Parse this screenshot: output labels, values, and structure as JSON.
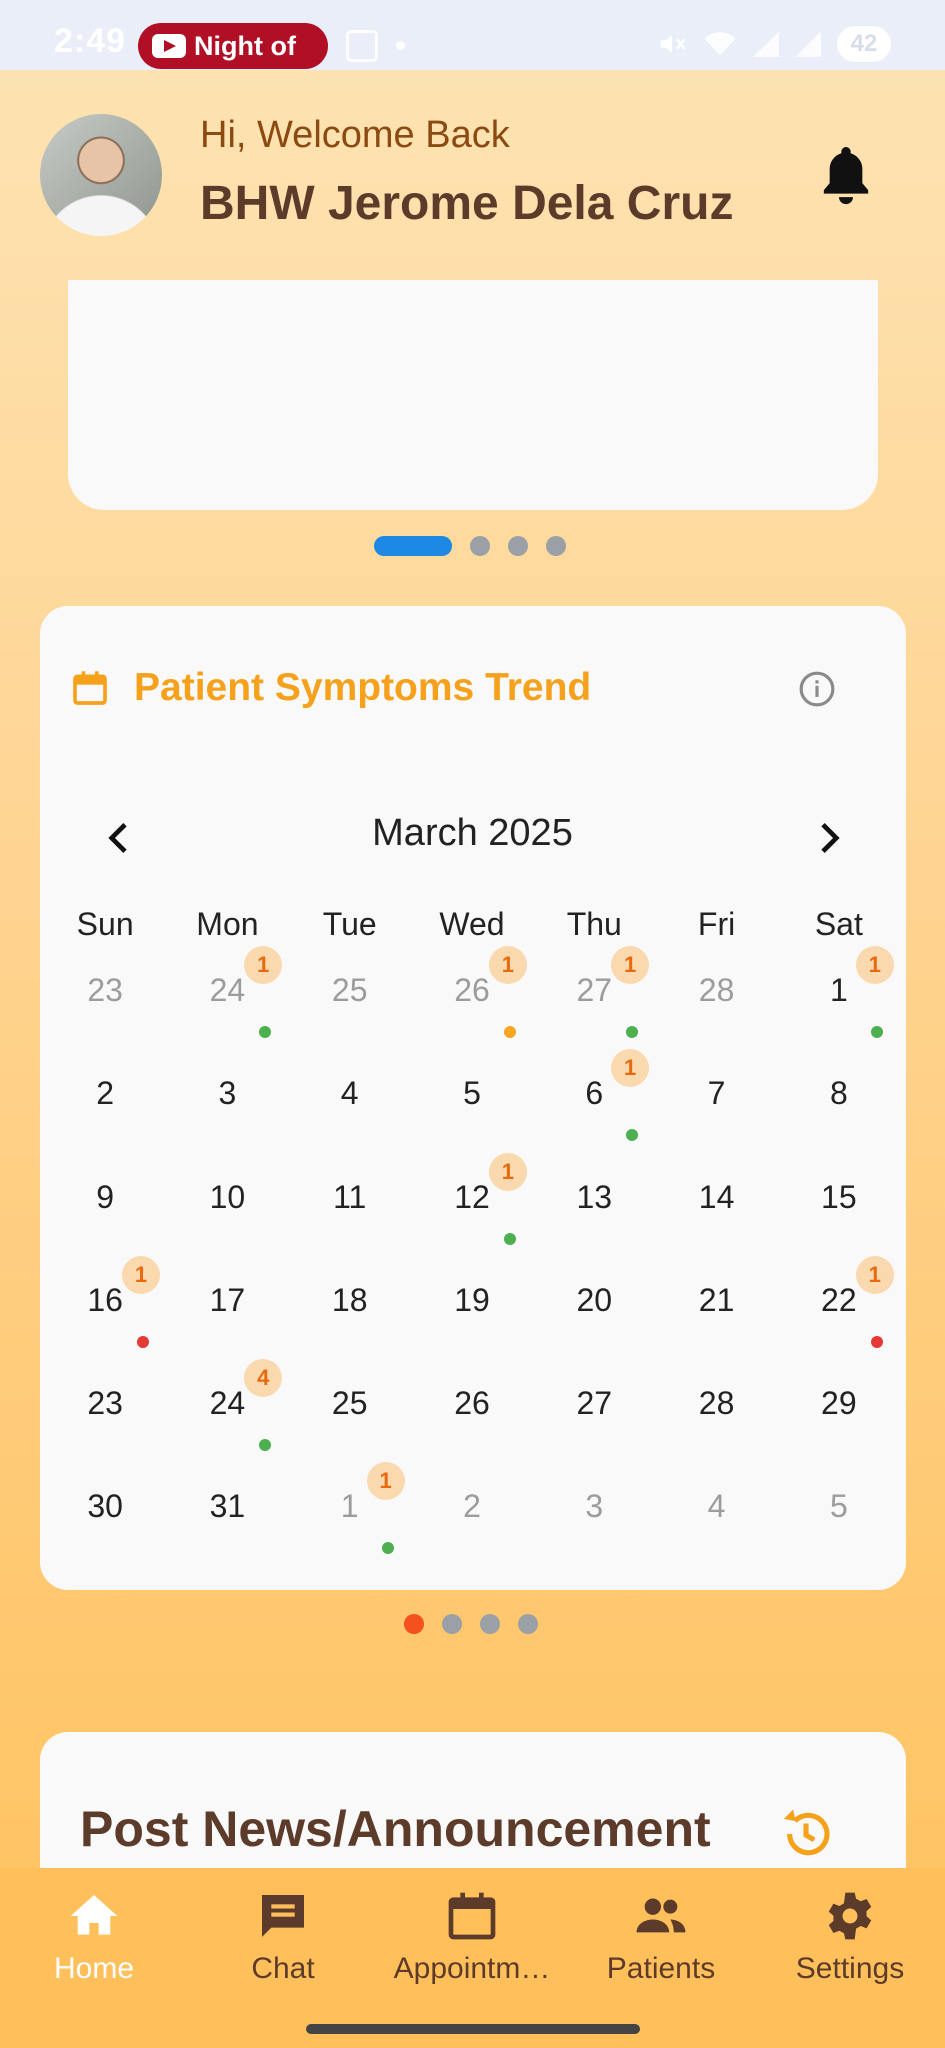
{
  "status_bar": {
    "time": "2:49",
    "media_pill_text": "Night of",
    "battery": "42",
    "icons": [
      "youtube-icon",
      "screenshot-icon",
      "mute-icon",
      "wifi-icon",
      "signal-icon",
      "signal-icon",
      "battery-icon"
    ]
  },
  "header": {
    "greeting": "Hi, Welcome Back",
    "user_name": "BHW Jerome Dela Cruz",
    "notification_icon": "bell-icon"
  },
  "carousel": {
    "pages": 4,
    "active_page": 1,
    "active_color": "#1e88e5"
  },
  "symptoms_card": {
    "title": "Patient Symptoms Trend",
    "title_color": "#f5a11b",
    "month_label": "March 2025",
    "weekdays": [
      "Sun",
      "Mon",
      "Tue",
      "Wed",
      "Thu",
      "Fri",
      "Sat"
    ],
    "days": [
      {
        "n": "23",
        "muted": true
      },
      {
        "n": "24",
        "muted": true,
        "badge": "1",
        "mark": "#4caf50"
      },
      {
        "n": "25",
        "muted": true
      },
      {
        "n": "26",
        "muted": true,
        "badge": "1",
        "mark": "#f5a623"
      },
      {
        "n": "27",
        "muted": true,
        "badge": "1",
        "mark": "#4caf50"
      },
      {
        "n": "28",
        "muted": true
      },
      {
        "n": "1",
        "badge": "1",
        "mark": "#4caf50"
      },
      {
        "n": "2"
      },
      {
        "n": "3"
      },
      {
        "n": "4"
      },
      {
        "n": "5"
      },
      {
        "n": "6",
        "badge": "1",
        "mark": "#4caf50"
      },
      {
        "n": "7"
      },
      {
        "n": "8"
      },
      {
        "n": "9"
      },
      {
        "n": "10"
      },
      {
        "n": "11"
      },
      {
        "n": "12",
        "badge": "1",
        "mark": "#4caf50"
      },
      {
        "n": "13"
      },
      {
        "n": "14"
      },
      {
        "n": "15"
      },
      {
        "n": "16",
        "badge": "1",
        "mark": "#e53935"
      },
      {
        "n": "17"
      },
      {
        "n": "18"
      },
      {
        "n": "19"
      },
      {
        "n": "20"
      },
      {
        "n": "21"
      },
      {
        "n": "22",
        "badge": "1",
        "mark": "#e53935"
      },
      {
        "n": "23"
      },
      {
        "n": "24",
        "badge": "4",
        "mark": "#4caf50"
      },
      {
        "n": "25"
      },
      {
        "n": "26"
      },
      {
        "n": "27"
      },
      {
        "n": "28"
      },
      {
        "n": "29"
      },
      {
        "n": "30"
      },
      {
        "n": "31"
      },
      {
        "n": "1",
        "muted": true,
        "badge": "1",
        "mark": "#4caf50"
      },
      {
        "n": "2",
        "muted": true
      },
      {
        "n": "3",
        "muted": true
      },
      {
        "n": "4",
        "muted": true
      },
      {
        "n": "5",
        "muted": true
      }
    ],
    "pages": 4,
    "active_page": 1,
    "active_color": "#f4511e"
  },
  "announcement_card": {
    "title": "Post News/Announcement",
    "icon": "history-icon"
  },
  "bottom_nav": {
    "items": [
      {
        "label": "Home",
        "icon": "home-icon",
        "active": true
      },
      {
        "label": "Chat",
        "icon": "chat-icon"
      },
      {
        "label": "Appointm…",
        "icon": "calendar-icon"
      },
      {
        "label": "Patients",
        "icon": "people-icon"
      },
      {
        "label": "Settings",
        "icon": "gear-icon"
      }
    ]
  }
}
